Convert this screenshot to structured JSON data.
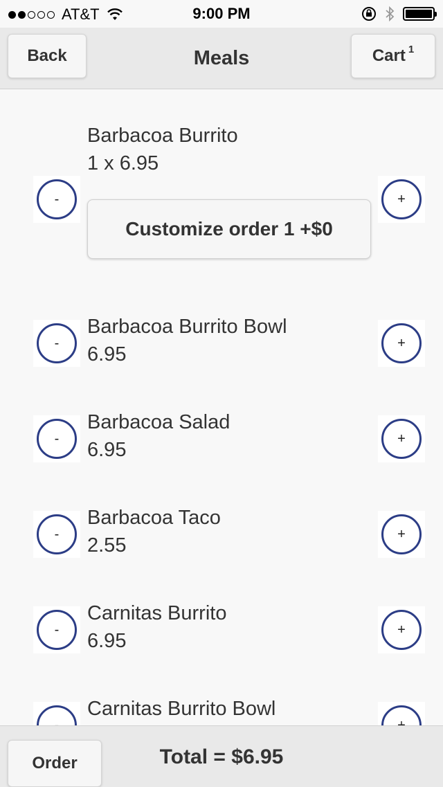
{
  "status_bar": {
    "signal_full": 2,
    "signal_total": 5,
    "carrier": "AT&T",
    "time": "9:00 PM",
    "icons": [
      "wifi-icon",
      "orientation-lock-icon",
      "bluetooth-icon",
      "battery-icon"
    ],
    "battery_level": 1.0
  },
  "header": {
    "title": "Meals",
    "back_label": "Back",
    "cart_label": "Cart",
    "cart_count": "1"
  },
  "items": [
    {
      "name": "Barbacoa Burrito",
      "price": "1 x 6.95",
      "customize_label": "Customize order 1 +$0"
    },
    {
      "name": "Barbacoa Burrito Bowl",
      "price": "6.95"
    },
    {
      "name": "Barbacoa Salad",
      "price": "6.95"
    },
    {
      "name": "Barbacoa Taco",
      "price": "2.55"
    },
    {
      "name": "Carnitas Burrito",
      "price": "6.95"
    },
    {
      "name": "Carnitas Burrito Bowl",
      "price": ""
    }
  ],
  "buttons": {
    "minus": "-",
    "plus": "+"
  },
  "footer": {
    "order_label": "Order",
    "total": "Total = $6.95"
  },
  "colors": {
    "accent": "#2c3d86",
    "bar_background": "#e9e9e9",
    "page_background": "#f8f8f8"
  }
}
